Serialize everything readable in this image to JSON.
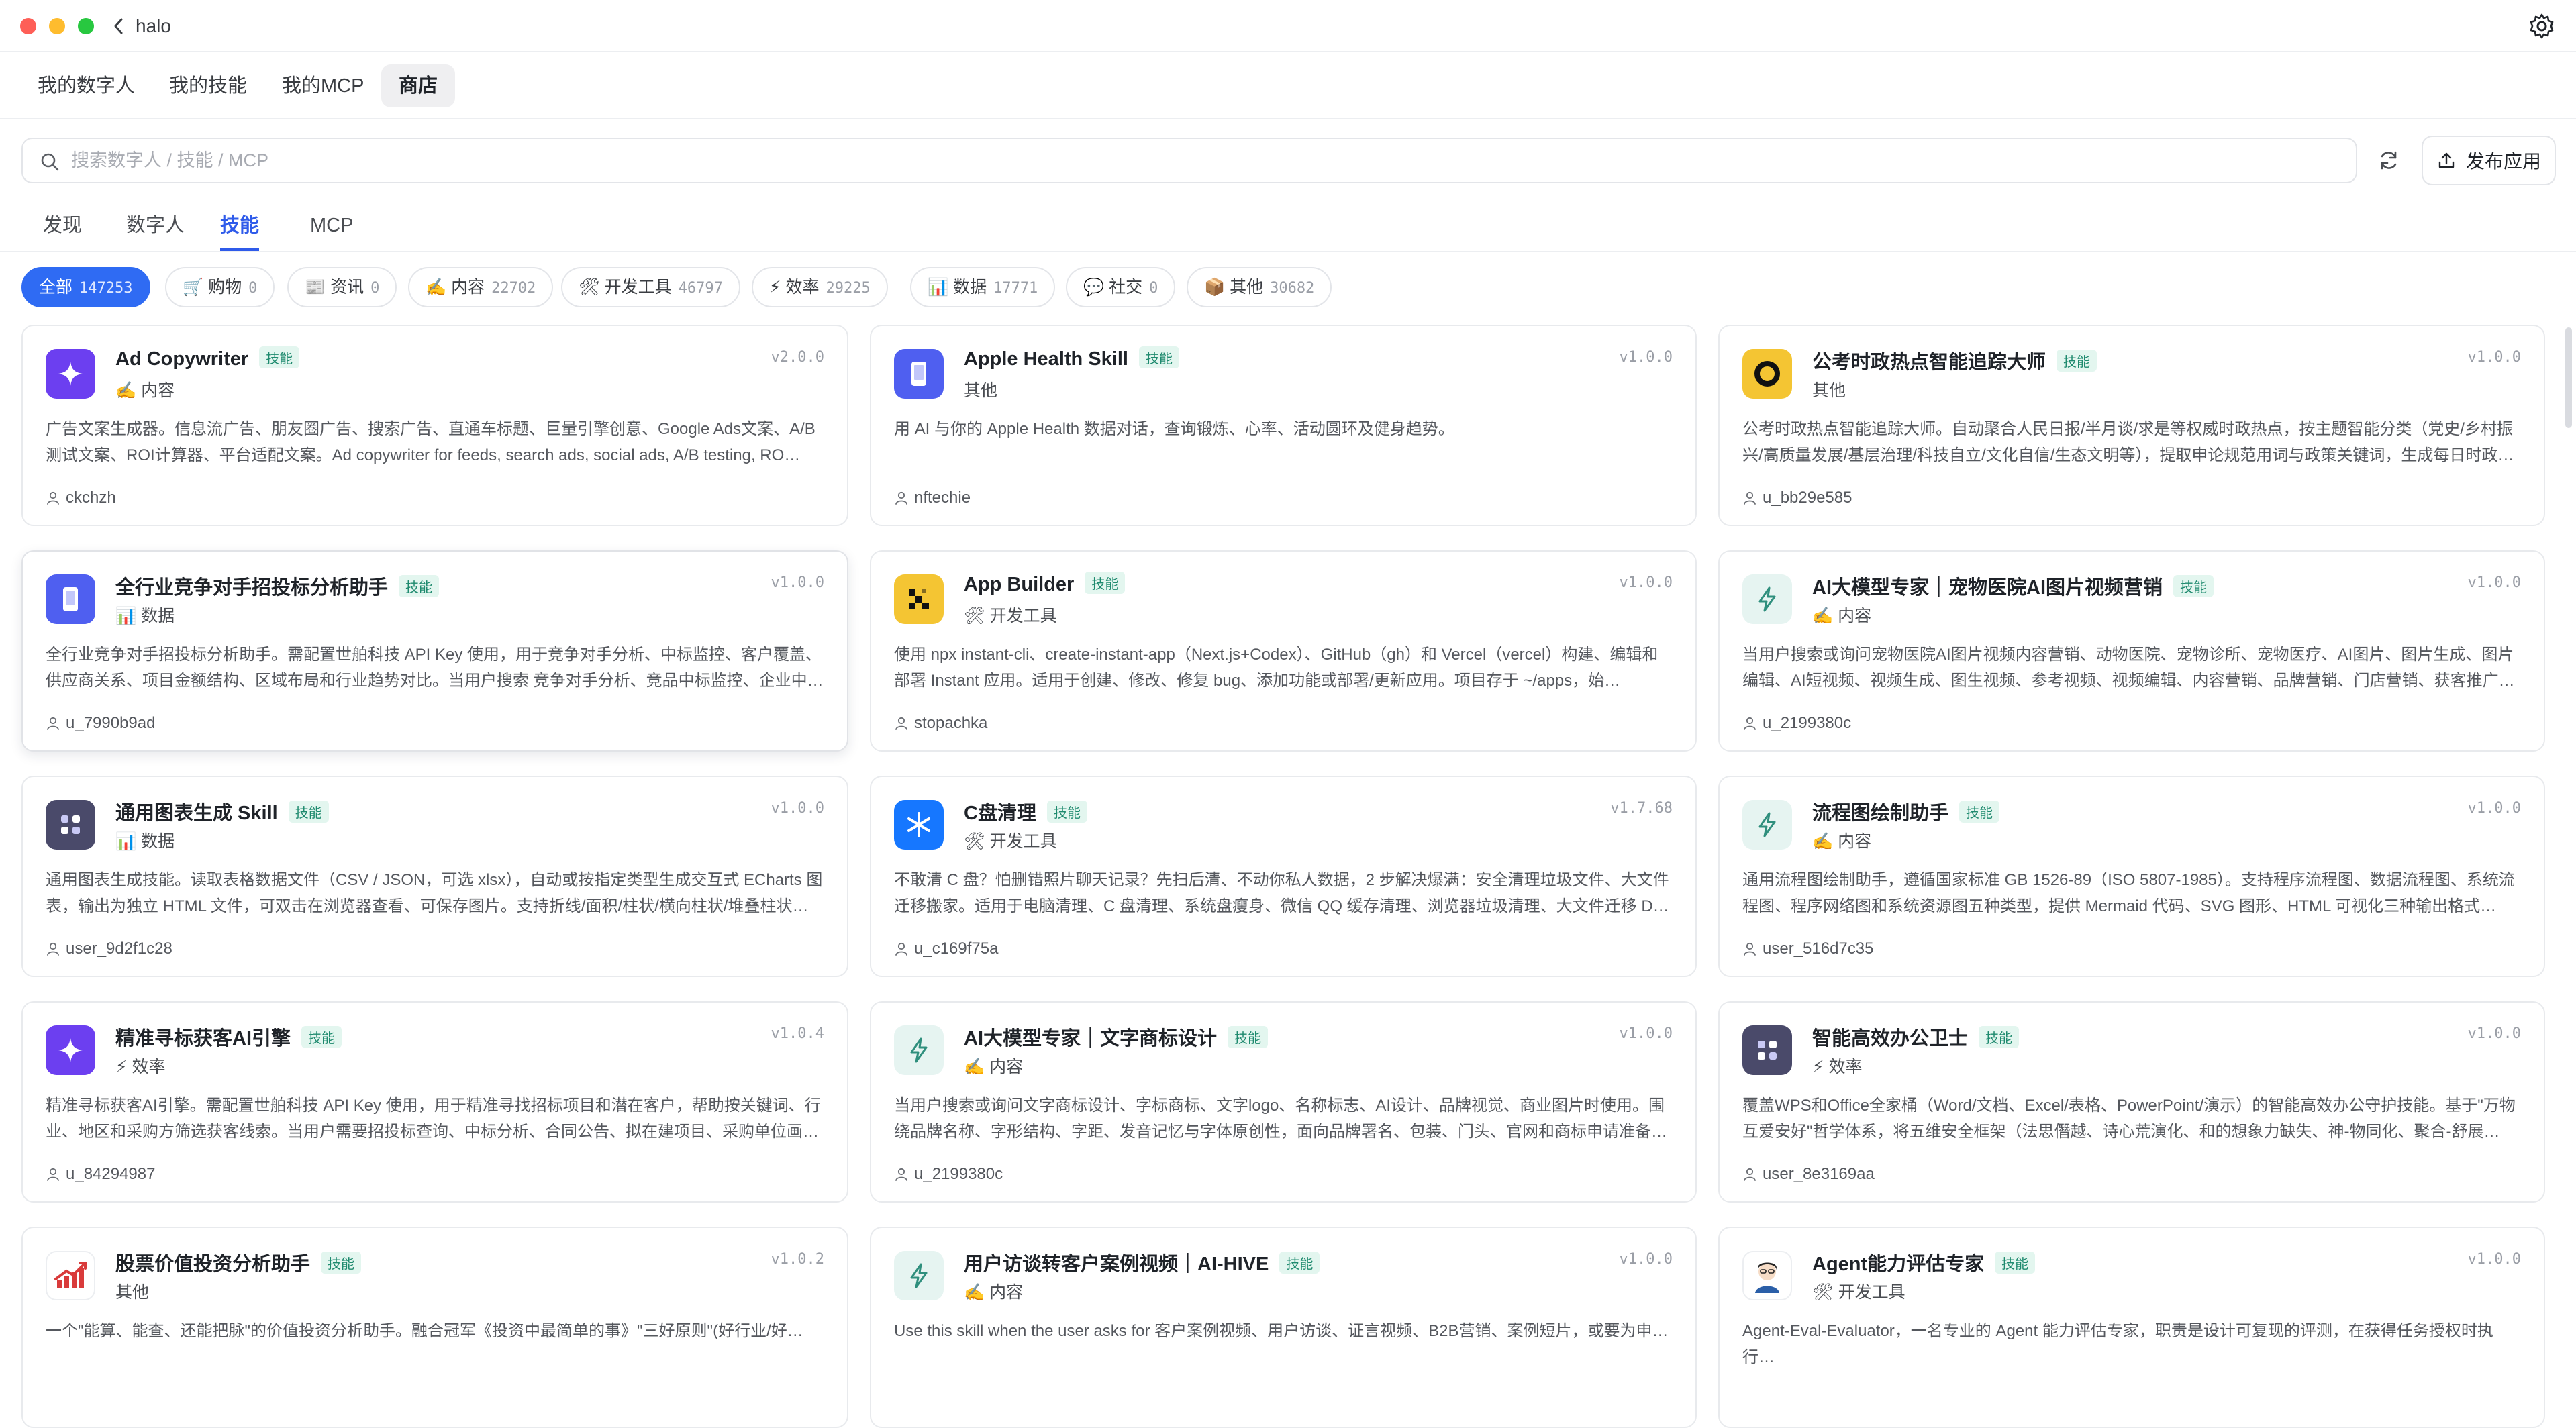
{
  "window": {
    "title": "halo"
  },
  "nav_tabs": [
    {
      "label": "我的数字人",
      "active": false
    },
    {
      "label": "我的技能",
      "active": false
    },
    {
      "label": "我的MCP",
      "active": false
    },
    {
      "label": "商店",
      "active": true
    }
  ],
  "search": {
    "placeholder": "搜索数字人 / 技能 / MCP",
    "value": ""
  },
  "actions": {
    "publish_label": "发布应用"
  },
  "sub_tabs": [
    {
      "label": "发现",
      "active": false
    },
    {
      "label": "数字人",
      "active": false
    },
    {
      "label": "技能",
      "active": true
    },
    {
      "label": "MCP",
      "active": false
    }
  ],
  "categories": [
    {
      "label": "全部",
      "count": "147253",
      "active": true
    },
    {
      "label": "🛒 购物",
      "count": "0",
      "active": false
    },
    {
      "label": "📰 资讯",
      "count": "0",
      "active": false
    },
    {
      "label": "✍️ 内容",
      "count": "22702",
      "active": false
    },
    {
      "label": "🛠 开发工具",
      "count": "46797",
      "active": false
    },
    {
      "label": "⚡ 效率",
      "count": "29225",
      "active": false
    },
    {
      "label": "📊 数据",
      "count": "17771",
      "active": false
    },
    {
      "label": "💬 社交",
      "count": "0",
      "active": false
    },
    {
      "label": "📦 其他",
      "count": "30682",
      "active": false
    }
  ],
  "cards": [
    {
      "name": "Ad Copywriter",
      "badge": "技能",
      "category": "✍️ 内容",
      "version": "v2.0.0",
      "description": "广告文案生成器。信息流广告、朋友圈广告、搜索广告、直通车标题、巨量引擎创意、Google Ads文案、A/B测试文案、ROI计算器、平台适配文案。Ad copywriter for feeds, search ads, social ads, A/B testing, RO…",
      "author": "ckchzh",
      "icon": "sparkle-icon",
      "icon_color": "#6c3ff0"
    },
    {
      "name": "Apple Health Skill",
      "badge": "技能",
      "category": "其他",
      "version": "v1.0.0",
      "description": "用 AI 与你的 Apple Health 数据对话，查询锻炼、心率、活动圆环及健身趋势。",
      "author": "nftechie",
      "icon": "phone-icon",
      "icon_color": "#4f5ff0"
    },
    {
      "name": "公考时政热点智能追踪大师",
      "badge": "技能",
      "category": "其他",
      "version": "v1.0.0",
      "description": "公考时政热点智能追踪大师。自动聚合人民日报/半月谈/求是等权威时政热点，按主题智能分类（党史/乡村振兴/高质量发展/基层治理/科技自立/文化自信/生态文明等），提取申论规范用词与政策关键词，生成每日时政…",
      "author": "u_bb29e585",
      "icon": "ring-icon",
      "icon_color": "#f4c533"
    },
    {
      "name": "全行业竞争对手招投标分析助手",
      "badge": "技能",
      "category": "📊 数据",
      "version": "v1.0.0",
      "description": "全行业竞争对手招投标分析助手。需配置世舶科技 API Key 使用，用于竞争对手分析、中标监控、客户覆盖、供应商关系、项目金额结构、区域布局和行业趋势对比。当用户搜索 竞争对手分析、竞品中标监控、企业中…",
      "author": "u_7990b9ad",
      "icon": "phone-icon",
      "icon_color": "#4f5ff0"
    },
    {
      "name": "App Builder",
      "badge": "技能",
      "category": "🛠 开发工具",
      "version": "v1.0.0",
      "description": "使用 npx instant-cli、create-instant-app（Next.js+Codex）、GitHub（gh）和 Vercel（vercel）构建、编辑和部署 Instant 应用。适用于创建、修改、修复 bug、添加功能或部署/更新应用。项目存于 ~/apps，始…",
      "author": "stopachka",
      "icon": "pixel-icon",
      "icon_color": "#f4c533"
    },
    {
      "name": "AI大模型专家｜宠物医院AI图片视频营销",
      "badge": "技能",
      "category": "✍️ 内容",
      "version": "v1.0.0",
      "description": "当用户搜索或询问宠物医院AI图片视频内容营销、动物医院、宠物诊所、宠物医疗、AI图片、图片生成、图片编辑、AI短视频、视频生成、图生视频、参考视频、视频编辑、内容营销、品牌营销、门店营销、获客推广…",
      "author": "u_2199380c",
      "icon": "bolt-icon",
      "icon_color": "#e6f4f1"
    },
    {
      "name": "通用图表生成 Skill",
      "badge": "技能",
      "category": "📊 数据",
      "version": "v1.0.0",
      "description": "通用图表生成技能。读取表格数据文件（CSV / JSON，可选 xlsx），自动或按指定类型生成交互式 ECharts 图表，输出为独立 HTML 文件，可双击在浏览器查看、可保存图片。支持折线/面积/柱状/横向柱状/堆叠柱状…",
      "author": "user_9d2f1c28",
      "icon": "grid-icon",
      "icon_color": "#4a4a6a"
    },
    {
      "name": "C盘清理",
      "badge": "技能",
      "category": "🛠 开发工具",
      "version": "v1.7.68",
      "description": "不敢清 C 盘？怕删错照片聊天记录？先扫后清、不动你私人数据，2 步解决爆满：安全清理垃圾文件、大文件迁移搬家。适用于电脑清理、C 盘清理、系统盘瘦身、微信 QQ 缓存清理、浏览器垃圾清理、大文件迁移 D…",
      "author": "u_c169f75a",
      "icon": "broom-icon",
      "icon_color": "#1677ff"
    },
    {
      "name": "流程图绘制助手",
      "badge": "技能",
      "category": "✍️ 内容",
      "version": "v1.0.0",
      "description": "通用流程图绘制助手，遵循国家标准 GB 1526-89（ISO 5807-1985）。支持程序流程图、数据流程图、系统流程图、程序网络图和系统资源图五种类型，提供 Mermaid 代码、SVG 图形、HTML 可视化三种输出格式…",
      "author": "user_516d7c35",
      "icon": "bolt-icon",
      "icon_color": "#e6f4f1"
    },
    {
      "name": "精准寻标获客AI引擎",
      "badge": "技能",
      "category": "⚡ 效率",
      "version": "v1.0.4",
      "description": "精准寻标获客AI引擎。需配置世舶科技 API Key 使用，用于精准寻找招标项目和潜在客户，帮助按关键词、行业、地区和采购方筛选获客线索。当用户需要招投标查询、中标分析、合同公告、拟在建项目、采购单位画…",
      "author": "u_84294987",
      "icon": "sparkle-icon",
      "icon_color": "#6c3ff0"
    },
    {
      "name": "AI大模型专家｜文字商标设计",
      "badge": "技能",
      "category": "✍️ 内容",
      "version": "v1.0.0",
      "description": "当用户搜索或询问文字商标设计、字标商标、文字logo、名称标志、AI设计、品牌视觉、商业图片时使用。围绕品牌名称、字形结构、字距、发音记忆与字体原创性，面向品牌署名、包装、门头、官网和商标申请准备…",
      "author": "u_2199380c",
      "icon": "bolt-icon",
      "icon_color": "#e6f4f1"
    },
    {
      "name": "智能高效办公卫士",
      "badge": "技能",
      "category": "⚡ 效率",
      "version": "v1.0.0",
      "description": "覆盖WPS和Office全家桶（Word/文档、Excel/表格、PowerPoint/演示）的智能高效办公守护技能。基于\"万物互爱安好\"哲学体系，将五维安全框架（法思僭越、诗心荒演化、和的想象力缺失、神-物同化、聚合-舒展…",
      "author": "user_8e3169aa",
      "icon": "grid-icon",
      "icon_color": "#4a4a6a"
    },
    {
      "name": "股票价值投资分析助手",
      "badge": "技能",
      "category": "其他",
      "version": "v1.0.2",
      "description": "一个\"能算、能查、还能把脉\"的价值投资分析助手。融合冠军《投资中最简单的事》\"三好原则\"(好行业/好…",
      "author": "",
      "icon": "chart-icon",
      "icon_color": "#ffffff"
    },
    {
      "name": "用户访谈转客户案例视频｜AI-HIVE",
      "badge": "技能",
      "category": "✍️ 内容",
      "version": "v1.0.0",
      "description": "Use this skill when the user asks for 客户案例视频、用户访谈、证言视频、B2B营销、案例短片，或要为申…",
      "author": "",
      "icon": "bolt-icon",
      "icon_color": "#e6f4f1"
    },
    {
      "name": "Agent能力评估专家",
      "badge": "技能",
      "category": "🛠 开发工具",
      "version": "v1.0.0",
      "description": "Agent-Eval-Evaluator，一名专业的 Agent 能力评估专家，职责是设计可复现的评测，在获得任务授权时执行…",
      "author": "",
      "icon": "avatar-icon",
      "icon_color": "#ffffff"
    }
  ]
}
